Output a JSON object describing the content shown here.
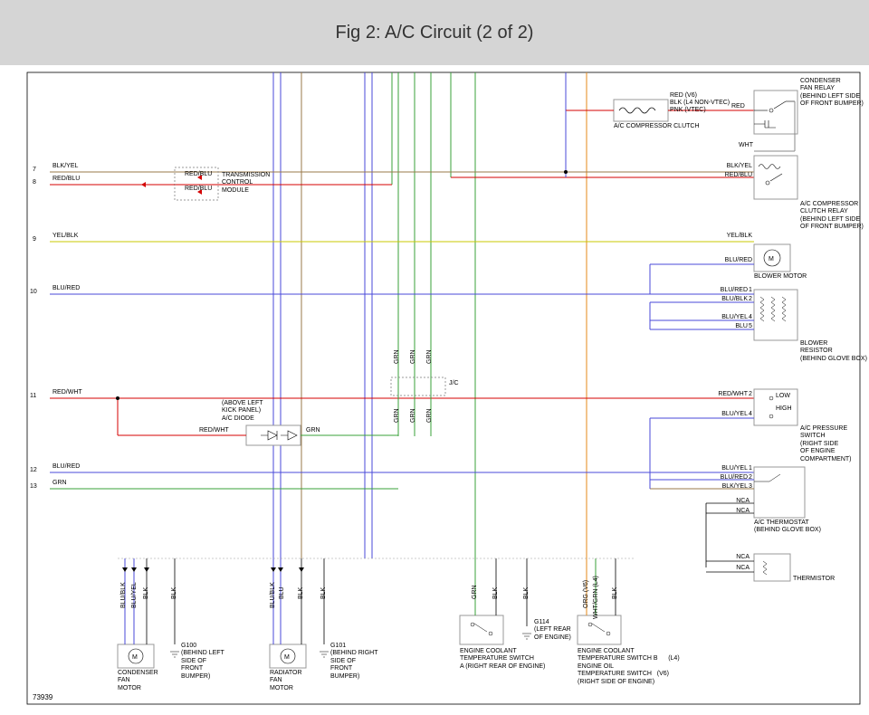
{
  "title": "Fig 2: A/C Circuit (2 of 2)",
  "doc_id": "73939",
  "pins": {
    "7": "7",
    "8": "8",
    "9": "9",
    "10": "10",
    "11": "11",
    "12": "12",
    "13": "13"
  },
  "wires": {
    "blk_yel": "BLK/YEL",
    "red_blu": "RED/BLU",
    "yel_blk": "YEL/BLK",
    "blu_red": "BLU/RED",
    "red_wht": "RED/WHT",
    "grn": "GRN",
    "red": "RED",
    "blk_v6": "RED  (V6)",
    "l4_nonvtec": "BLK  (L4 NON-VTEC)",
    "pnk_vtec": "PNK  (VTEC)",
    "wht": "WHT",
    "blu_blk": "BLU/BLK",
    "blu_yel": "BLU/YEL",
    "blu": "BLU",
    "blk_yel2": "BLK/YEL",
    "nca": "NCA",
    "blk": "BLK",
    "org_v6": "ORG  (V6)",
    "wht_grn_l4": "WHT/GRN   (L4)"
  },
  "components": {
    "condenser_fan_relay": "CONDENSER\nFAN RELAY\n(BEHIND LEFT SIDE\nOF FRONT BUMPER)",
    "ac_comp_clutch": "A/C COMPRESSOR CLUTCH",
    "tcm": "TRANSMISSION\nCONTROL\nMODULE",
    "ac_comp_clutch_relay": "A/C COMPRESSOR\nCLUTCH RELAY\n(BEHIND LEFT SIDE\nOF FRONT BUMPER)",
    "blower_motor": "BLOWER MOTOR",
    "blower_resistor": "BLOWER\nRESISTOR\n(BEHIND GLOVE BOX)",
    "jc": "J/C",
    "ac_diode": "(ABOVE LEFT\nKICK PANEL)\nA/C DIODE",
    "ac_pressure_switch": "A/C PRESSURE\nSWITCH\n(RIGHT SIDE\nOF ENGINE\nCOMPARTMENT)",
    "low": "LOW",
    "high": "HIGH",
    "ac_thermostat": "A/C THERMOSTAT\n(BEHIND GLOVE BOX)",
    "thermistor": "THERMISTOR",
    "condenser_fan_motor": "CONDENSER\nFAN\nMOTOR",
    "g100": "G100\n(BEHIND LEFT\nSIDE OF\nFRONT\nBUMPER)",
    "radiator_fan_motor": "RADIATOR\nFAN\nMOTOR",
    "g101": "G101\n(BEHIND RIGHT\nSIDE OF\nFRONT\nBUMPER)",
    "ect_switch_a": "ENGINE COOLANT\nTEMPERATURE SWITCH\nA (RIGHT REAR OF ENGINE)",
    "g114": "G114\n(LEFT REAR\nOF ENGINE)",
    "ect_switch_b": "ENGINE COOLANT\nTEMPERATURE SWITCH B      (L4)\nENGINE OIL\nTEMPERATURE SWITCH   (V6)\n(RIGHT SIDE OF ENGINE)"
  },
  "resistor_nums": {
    "n1": "1",
    "n2": "2",
    "n4": "4",
    "n5": "5"
  },
  "pressure_nums": {
    "n2": "2",
    "n4": "4"
  },
  "thermostat_nums": {
    "n1": "1",
    "n2": "2",
    "n3": "3"
  }
}
